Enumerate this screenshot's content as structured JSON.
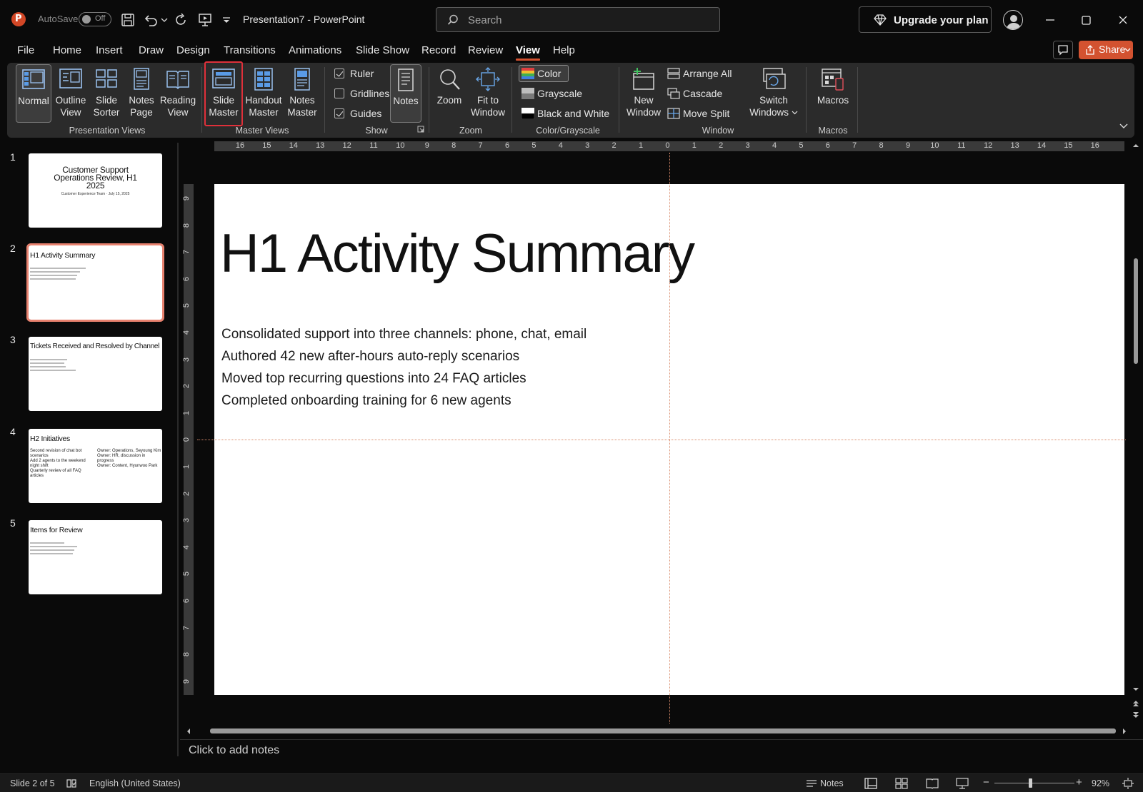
{
  "titlebar": {
    "autosave_label": "AutoSave",
    "autosave_state": "Off",
    "document_title": "Presentation7  -  PowerPoint",
    "search_placeholder": "Search",
    "upgrade_label": "Upgrade your plan"
  },
  "menu": {
    "tabs": [
      "File",
      "Home",
      "Insert",
      "Draw",
      "Design",
      "Transitions",
      "Animations",
      "Slide Show",
      "Record",
      "Review",
      "View",
      "Help"
    ],
    "active_tab": "View",
    "share_label": "Share"
  },
  "ribbon": {
    "presentation_views": {
      "label": "Presentation Views",
      "buttons": [
        {
          "line1": "Normal",
          "line2": ""
        },
        {
          "line1": "Outline",
          "line2": "View"
        },
        {
          "line1": "Slide",
          "line2": "Sorter"
        },
        {
          "line1": "Notes",
          "line2": "Page"
        },
        {
          "line1": "Reading",
          "line2": "View"
        }
      ]
    },
    "master_views": {
      "label": "Master Views",
      "buttons": [
        {
          "line1": "Slide",
          "line2": "Master"
        },
        {
          "line1": "Handout",
          "line2": "Master"
        },
        {
          "line1": "Notes",
          "line2": "Master"
        }
      ]
    },
    "show": {
      "label": "Show",
      "ruler": "Ruler",
      "gridlines": "Gridlines",
      "guides": "Guides",
      "notes": "Notes"
    },
    "zoom": {
      "label": "Zoom",
      "zoom_btn": "Zoom",
      "fit_line1": "Fit to",
      "fit_line2": "Window"
    },
    "color_grayscale": {
      "label": "Color/Grayscale",
      "color": "Color",
      "grayscale": "Grayscale",
      "bw": "Black and White"
    },
    "window": {
      "label": "Window",
      "new_line1": "New",
      "new_line2": "Window",
      "arrange_all": "Arrange All",
      "cascade": "Cascade",
      "move_split": "Move Split",
      "switch_line1": "Switch",
      "switch_line2": "Windows"
    },
    "macros": {
      "label": "Macros",
      "macros_btn": "Macros"
    }
  },
  "thumbnails": {
    "numbers": [
      "1",
      "2",
      "3",
      "4",
      "5"
    ],
    "slide1": {
      "title": "Customer Support Operations Review, H1 2025",
      "subtitle": "Customer Experience Team · July 15, 2025"
    },
    "slide2": {
      "title": "H1 Activity Summary"
    },
    "slide3": {
      "title": "Tickets Received and Resolved by Channel"
    },
    "slide4": {
      "title": "H2 Initiatives",
      "left": [
        "Second revision of chat bot scenarios",
        "Add 2 agents to the weekend night shift",
        "Quarterly review of all FAQ articles"
      ],
      "right": [
        "Owner: Operations, Seyoung Kim",
        "Owner: HR, discussion in progress",
        "Owner: Content, Hyunwoo Park"
      ]
    },
    "slide5": {
      "title": "Items for Review"
    }
  },
  "rulers": {
    "horizontal": [
      "16",
      "15",
      "14",
      "13",
      "12",
      "11",
      "10",
      "9",
      "8",
      "7",
      "6",
      "5",
      "4",
      "3",
      "2",
      "1",
      "0",
      "1",
      "2",
      "3",
      "4",
      "5",
      "6",
      "7",
      "8",
      "9",
      "10",
      "11",
      "12",
      "13",
      "14",
      "15",
      "16"
    ],
    "vertical": [
      "9",
      "8",
      "7",
      "6",
      "5",
      "4",
      "3",
      "2",
      "1",
      "0",
      "1",
      "2",
      "3",
      "4",
      "5",
      "6",
      "7",
      "8",
      "9"
    ]
  },
  "slide": {
    "title": "H1 Activity Summary",
    "bullets": [
      "Consolidated support into three channels: phone, chat, email",
      "Authored 42 new after-hours auto-reply scenarios",
      "Moved top recurring questions into 24 FAQ articles",
      "Completed onboarding training for 6 new agents"
    ]
  },
  "notes": {
    "placeholder": "Click to add notes"
  },
  "status": {
    "slide_position": "Slide 2 of 5",
    "language": "English (United States)",
    "notes_label": "Notes",
    "zoom_level": "92%"
  },
  "colors": {
    "accent": "#d35230",
    "highlight_red": "#e0303a",
    "selected_thumb": "#e8826f"
  }
}
